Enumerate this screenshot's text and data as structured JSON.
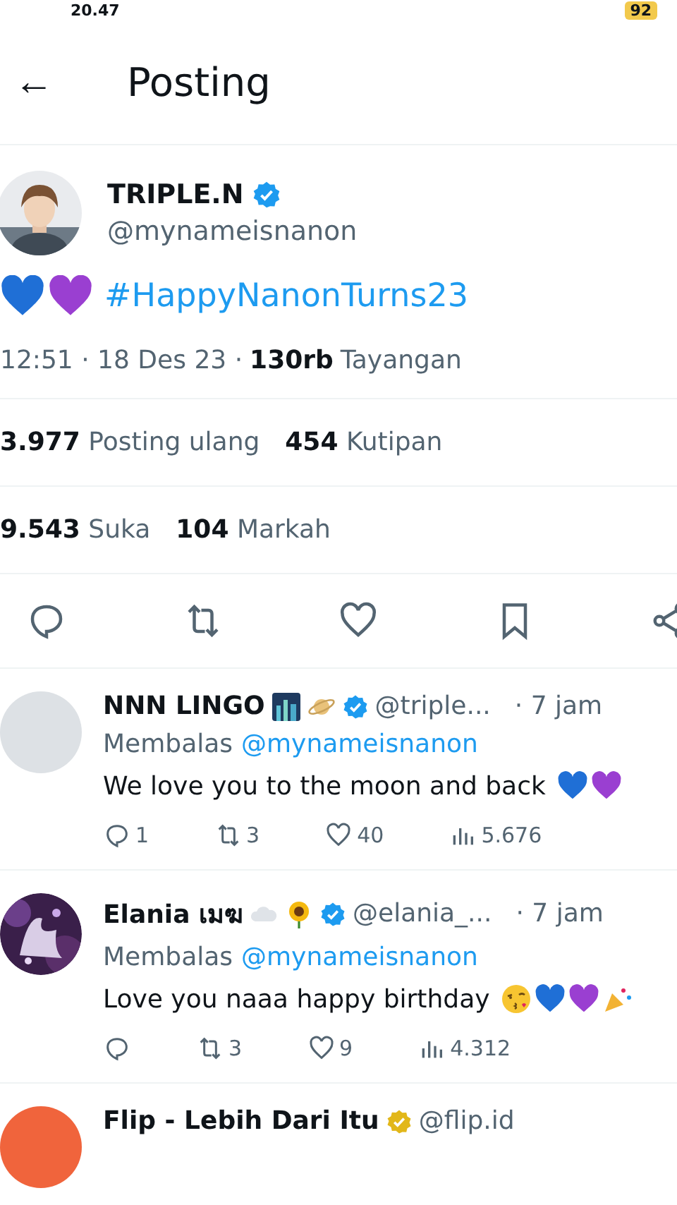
{
  "status_bar": {
    "time": "20.47",
    "battery": "92"
  },
  "header": {
    "back": "←",
    "title": "Posting"
  },
  "post": {
    "author": {
      "name": "TRIPLE.N",
      "handle": "@mynameisnanon",
      "verified": true
    },
    "hashtag": "#HappyNanonTurns23",
    "time": "12:51 · 18 Des 23 ·",
    "views_count": "130rb",
    "views_label": "Tayangan",
    "stats": [
      [
        {
          "count": "3.977",
          "label": "Posting ulang"
        },
        {
          "count": "454",
          "label": "Kutipan"
        }
      ],
      [
        {
          "count": "9.543",
          "label": "Suka"
        },
        {
          "count": "104",
          "label": "Markah"
        }
      ]
    ]
  },
  "replies": [
    {
      "name": "NNN LINGO",
      "badge": {
        "color": "#1d9bf0"
      },
      "handle": "@triple...",
      "age": "· 7 jam",
      "avatar": {
        "color": "#dde1e5"
      },
      "reply_prefix": "Membalas",
      "reply_to": "@mynameisnanon",
      "text": "We love you to the moon and back",
      "counts": {
        "reply": "1",
        "repost": "3",
        "like": "40",
        "views": "5.676"
      }
    },
    {
      "name": "Elania เมฆ",
      "badge": {
        "color": "#1d9bf0"
      },
      "handle": "@elania_...",
      "age": "· 7 jam",
      "reply_prefix": "Membalas",
      "reply_to": "@mynameisnanon",
      "text": "Love you naaa happy birthday",
      "counts": {
        "repost": "3",
        "like": "9",
        "views": "4.312"
      }
    },
    {
      "name": "Flip - Lebih Dari Itu",
      "badge": {
        "color": "#e2b719"
      },
      "handle": "@flip.id",
      "avatar": {
        "color": "#f0643c"
      }
    }
  ]
}
